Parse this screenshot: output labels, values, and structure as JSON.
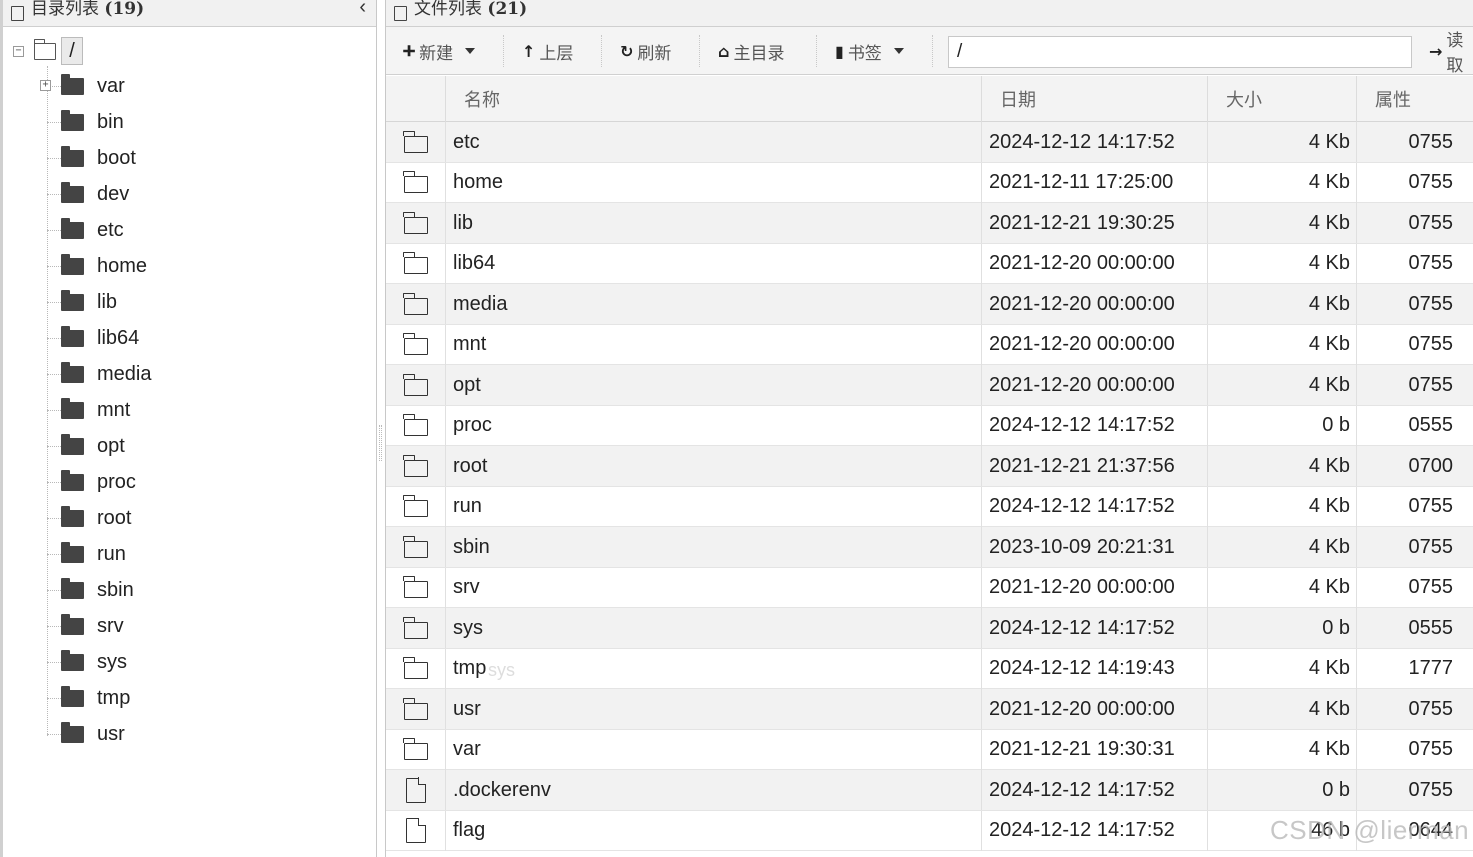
{
  "left_panel": {
    "title": "目录列表",
    "count": "(19)",
    "collapse_glyph": "‹",
    "root_label": "/",
    "expander_glyph": "−",
    "plus_glyph": "+",
    "items": [
      {
        "label": "var"
      },
      {
        "label": "bin"
      },
      {
        "label": "boot"
      },
      {
        "label": "dev"
      },
      {
        "label": "etc"
      },
      {
        "label": "home"
      },
      {
        "label": "lib"
      },
      {
        "label": "lib64"
      },
      {
        "label": "media"
      },
      {
        "label": "mnt"
      },
      {
        "label": "opt"
      },
      {
        "label": "proc"
      },
      {
        "label": "root"
      },
      {
        "label": "run"
      },
      {
        "label": "sbin"
      },
      {
        "label": "srv"
      },
      {
        "label": "sys"
      },
      {
        "label": "tmp"
      },
      {
        "label": "usr"
      }
    ]
  },
  "right_panel": {
    "title": "文件列表",
    "count": "(21)"
  },
  "toolbar": {
    "new_label": "新建",
    "new_icon": "plus-circle-icon",
    "up_label": "上层",
    "up_icon": "arrow-up-icon",
    "refresh_label": "刷新",
    "refresh_icon": "refresh-icon",
    "home_label": "主目录",
    "home_icon": "home-icon",
    "bookmark_label": "书签",
    "bookmark_icon": "bookmark-icon",
    "path_value": "/",
    "go_label": "读取",
    "go_icon": "arrow-right-icon"
  },
  "table": {
    "columns": {
      "name": "名称",
      "date": "日期",
      "size": "大小",
      "attr": "属性"
    },
    "rows": [
      {
        "type": "folder",
        "name": "etc",
        "date": "2024-12-12 14:17:52",
        "size": "4 Kb",
        "attr": "0755"
      },
      {
        "type": "folder",
        "name": "home",
        "date": "2021-12-11 17:25:00",
        "size": "4 Kb",
        "attr": "0755"
      },
      {
        "type": "folder",
        "name": "lib",
        "date": "2021-12-21 19:30:25",
        "size": "4 Kb",
        "attr": "0755"
      },
      {
        "type": "folder",
        "name": "lib64",
        "date": "2021-12-20 00:00:00",
        "size": "4 Kb",
        "attr": "0755"
      },
      {
        "type": "folder",
        "name": "media",
        "date": "2021-12-20 00:00:00",
        "size": "4 Kb",
        "attr": "0755"
      },
      {
        "type": "folder",
        "name": "mnt",
        "date": "2021-12-20 00:00:00",
        "size": "4 Kb",
        "attr": "0755"
      },
      {
        "type": "folder",
        "name": "opt",
        "date": "2021-12-20 00:00:00",
        "size": "4 Kb",
        "attr": "0755"
      },
      {
        "type": "folder",
        "name": "proc",
        "date": "2024-12-12 14:17:52",
        "size": "0 b",
        "attr": "0555"
      },
      {
        "type": "folder",
        "name": "root",
        "date": "2021-12-21 21:37:56",
        "size": "4 Kb",
        "attr": "0700"
      },
      {
        "type": "folder",
        "name": "run",
        "date": "2024-12-12 14:17:52",
        "size": "4 Kb",
        "attr": "0755"
      },
      {
        "type": "folder",
        "name": "sbin",
        "date": "2023-10-09 20:21:31",
        "size": "4 Kb",
        "attr": "0755"
      },
      {
        "type": "folder",
        "name": "srv",
        "date": "2021-12-20 00:00:00",
        "size": "4 Kb",
        "attr": "0755"
      },
      {
        "type": "folder",
        "name": "sys",
        "date": "2024-12-12 14:17:52",
        "size": "0 b",
        "attr": "0555"
      },
      {
        "type": "folder",
        "name": "tmp",
        "date": "2024-12-12 14:19:43",
        "size": "4 Kb",
        "attr": "1777"
      },
      {
        "type": "folder",
        "name": "usr",
        "date": "2021-12-20 00:00:00",
        "size": "4 Kb",
        "attr": "0755"
      },
      {
        "type": "folder",
        "name": "var",
        "date": "2021-12-21 19:30:31",
        "size": "4 Kb",
        "attr": "0755"
      },
      {
        "type": "file",
        "name": ".dockerenv",
        "date": "2024-12-12 14:17:52",
        "size": "0 b",
        "attr": "0755"
      },
      {
        "type": "file",
        "name": "flag",
        "date": "2024-12-12 14:17:52",
        "size": "46 b",
        "attr": "0644"
      }
    ]
  },
  "ghost_text": "sys",
  "watermark": "CSDN @lierman"
}
